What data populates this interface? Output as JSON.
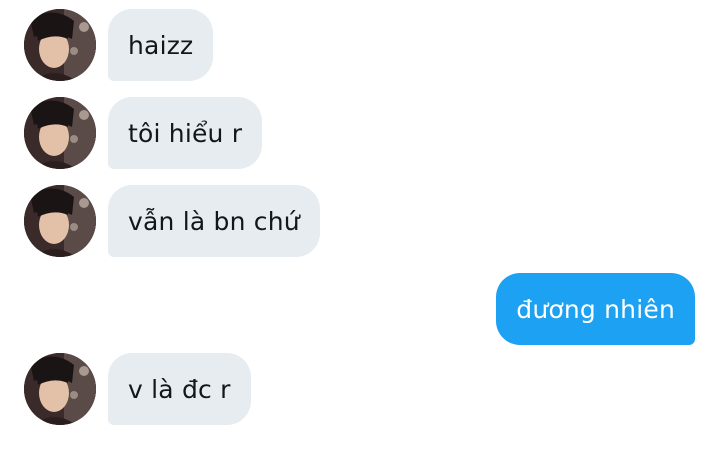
{
  "conversation": {
    "messages": [
      {
        "direction": "incoming",
        "text": "haizz",
        "avatar": "user-avatar"
      },
      {
        "direction": "incoming",
        "text": "tôi hiểu r",
        "avatar": "user-avatar"
      },
      {
        "direction": "incoming",
        "text": "vẫn là bn chứ",
        "avatar": "user-avatar"
      },
      {
        "direction": "outgoing",
        "text": "đương nhiên"
      },
      {
        "direction": "incoming",
        "text": "v là đc r",
        "avatar": "user-avatar"
      }
    ]
  },
  "colors": {
    "incoming_bubble": "#e6ecf0",
    "outgoing_bubble": "#1da1f2",
    "incoming_text": "#14171a",
    "outgoing_text": "#ffffff"
  }
}
